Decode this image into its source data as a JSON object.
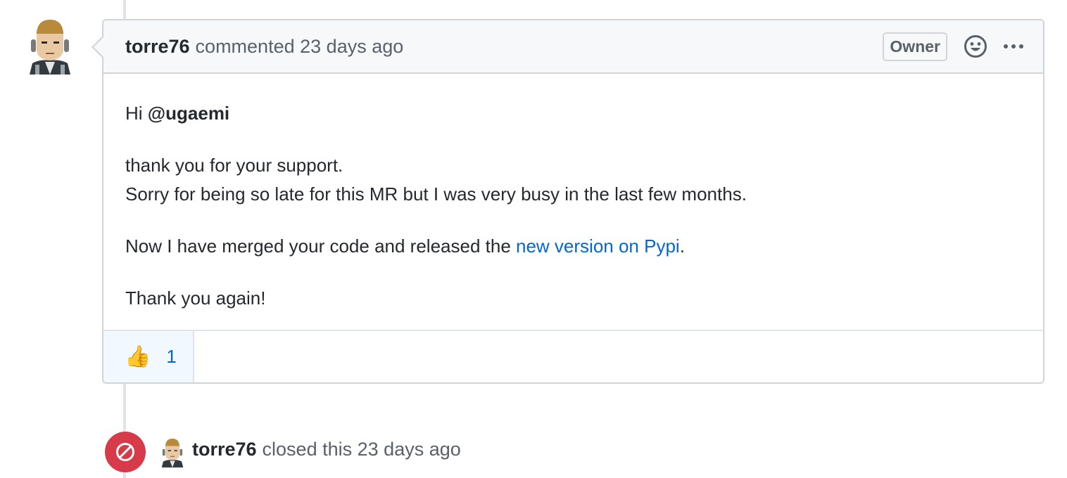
{
  "comment": {
    "author": "torre76",
    "action": "commented",
    "time": "23 days ago",
    "badge": "Owner",
    "icons": {
      "reaction": "smiley-icon",
      "more": "kebab-horizontal-icon"
    },
    "body": {
      "greeting": "Hi ",
      "mention": "@ugaemi",
      "line1": "thank you for your support.",
      "line2": "Sorry for being so late for this MR but I was very busy in the last few months.",
      "line3_prefix": "Now I have merged your code and released the ",
      "line3_link": "new version on Pypi",
      "line3_suffix": ".",
      "line4": "Thank you again!"
    },
    "reactions": [
      {
        "emoji": "👍",
        "icon": "thumbs-up-icon",
        "count": "1"
      }
    ]
  },
  "event": {
    "author": "torre76",
    "action": "closed this",
    "time": "23 days ago",
    "icon": "circle-slash-icon",
    "color": "#d73a49"
  },
  "colors": {
    "link": "#0366d6",
    "border": "#d1d5da",
    "header_bg": "#f6f8fa",
    "reaction_bg": "#f1f8ff"
  }
}
